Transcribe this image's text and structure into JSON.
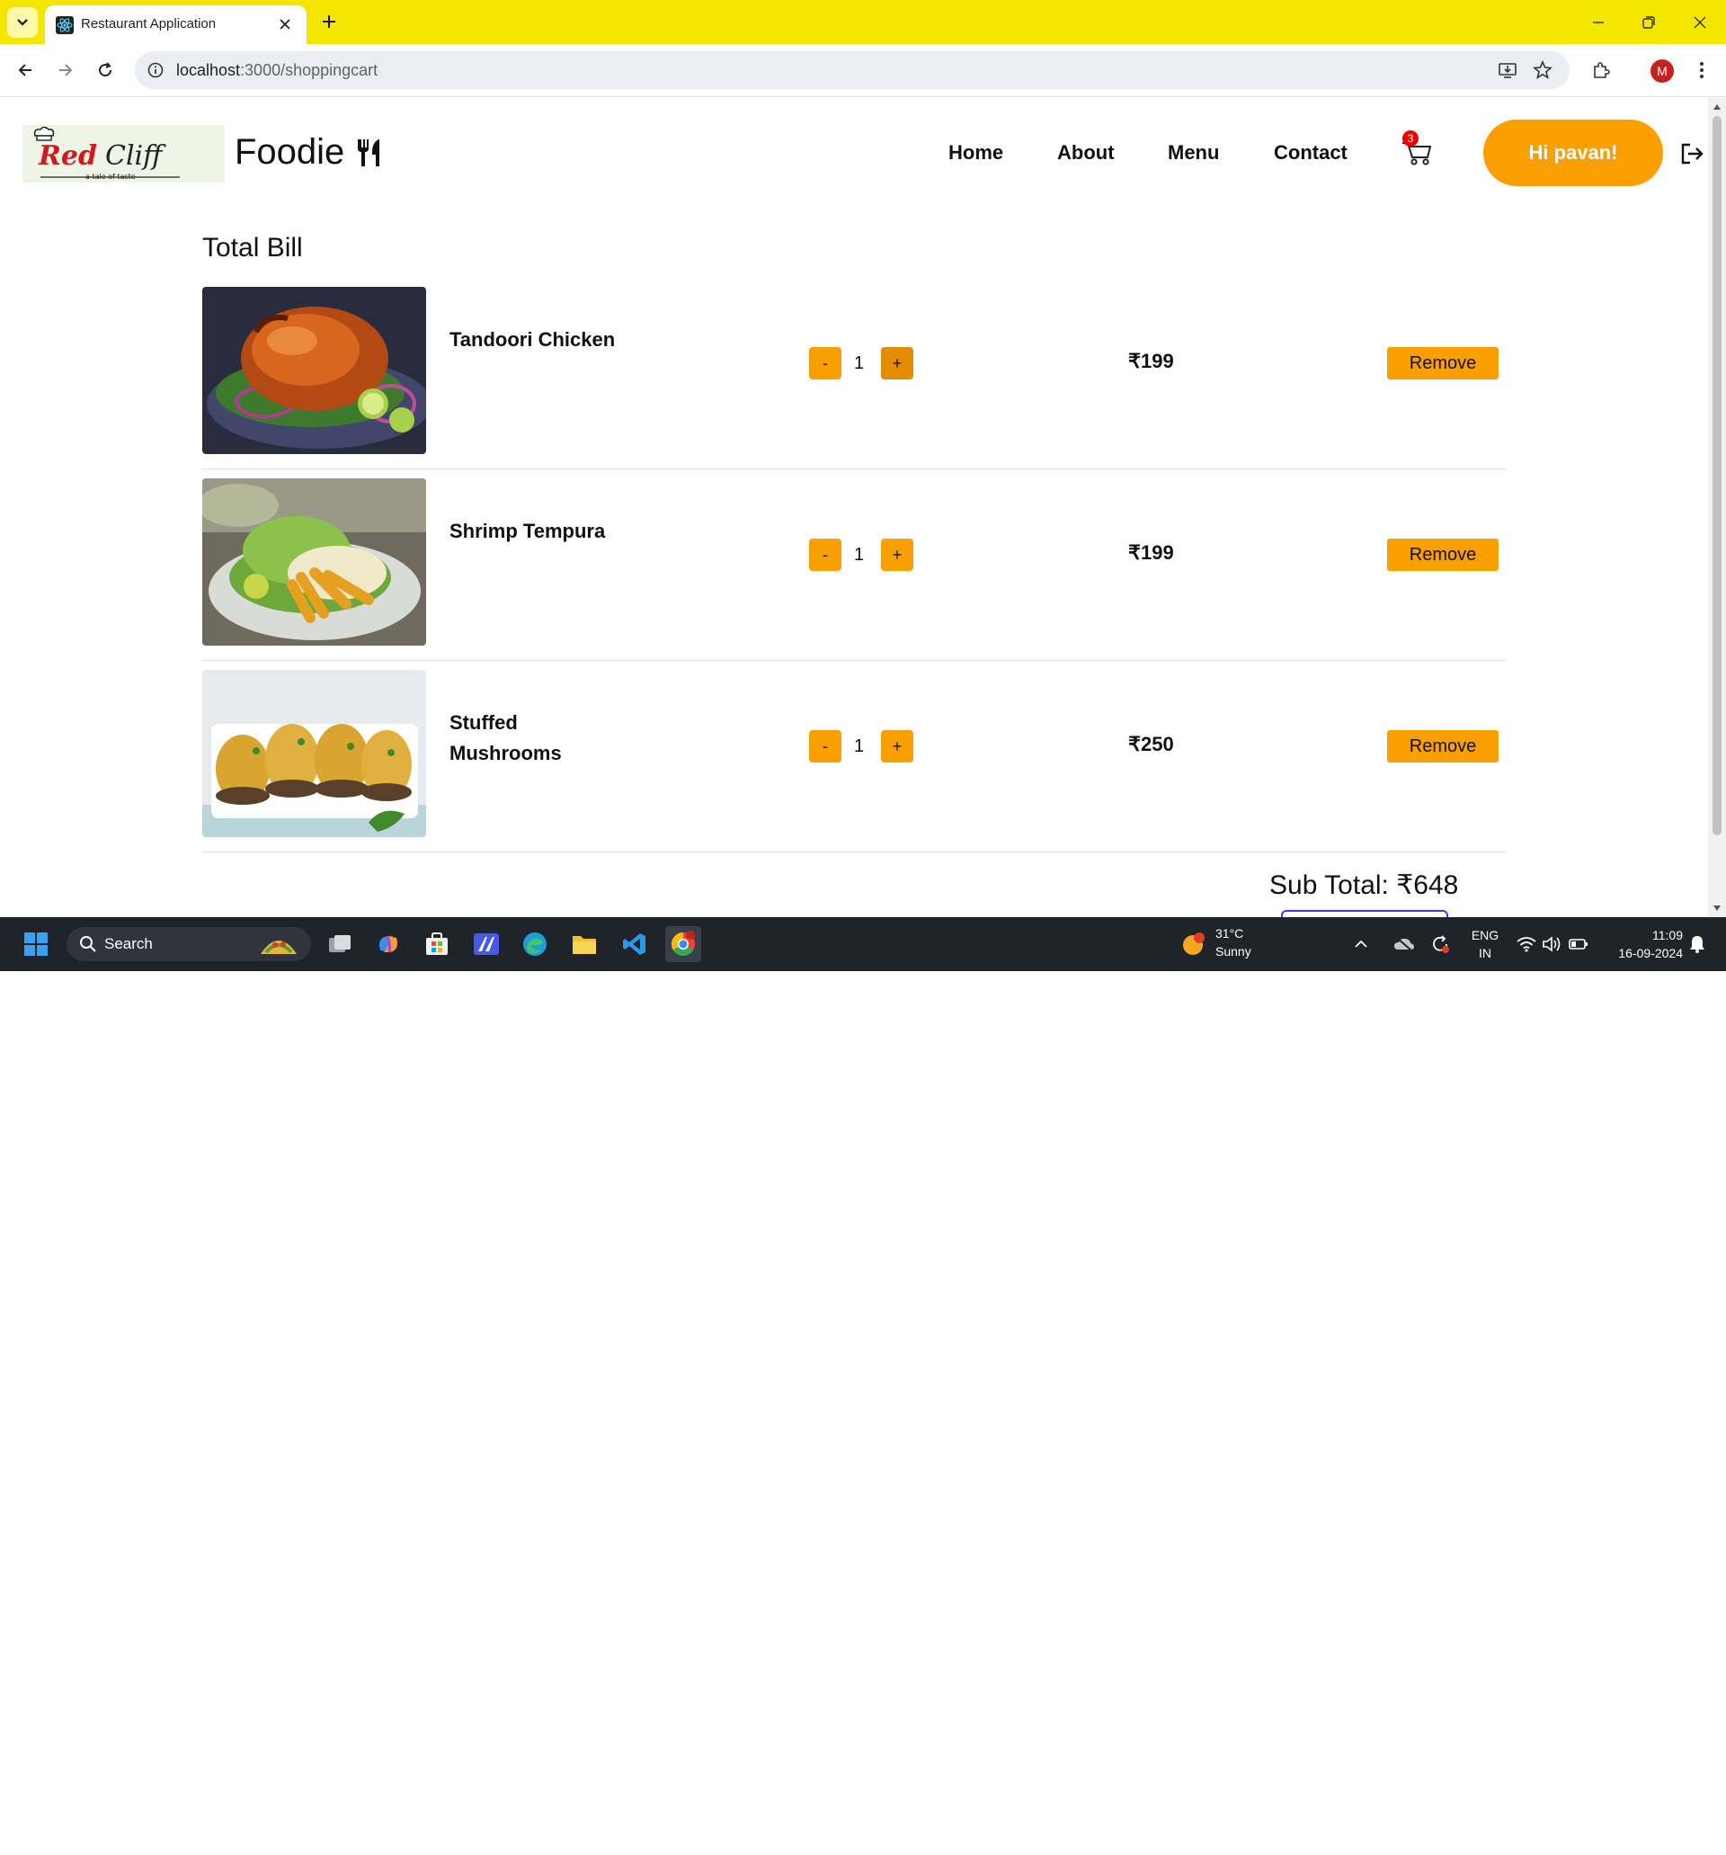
{
  "browser": {
    "tab_title": "Restaurant Application",
    "url_host": "localhost",
    "url_path": ":3000/shoppingcart",
    "profile_initial": "M"
  },
  "header": {
    "logo_text": "Red Cliff",
    "logo_tagline": "a tale of taste",
    "brand": "Foodie",
    "nav": [
      "Home",
      "About",
      "Menu",
      "Contact"
    ],
    "cart_count": "3",
    "greeting": "Hi pavan!"
  },
  "cart": {
    "title": "Total Bill",
    "items": [
      {
        "name": "Tandoori Chicken",
        "qty": "1",
        "price": "₹199",
        "remove_label": "Remove"
      },
      {
        "name": "Shrimp Tempura",
        "qty": "1",
        "price": "₹199",
        "remove_label": "Remove"
      },
      {
        "name": "Stuffed Mushrooms",
        "qty": "1",
        "price": "₹250",
        "remove_label": "Remove"
      }
    ],
    "minus_label": "-",
    "plus_label": "+",
    "subtotal": "Sub Total: ₹648"
  },
  "taskbar": {
    "search_label": "Search",
    "weather_temp": "31°C",
    "weather_desc": "Sunny",
    "weather_badge": "1",
    "lang_1": "ENG",
    "lang_2": "IN",
    "time": "11:09",
    "date": "16-09-2024"
  },
  "colors": {
    "accent": "#f9a000",
    "tabbar": "#f5e600",
    "badge": "#ee0000"
  }
}
